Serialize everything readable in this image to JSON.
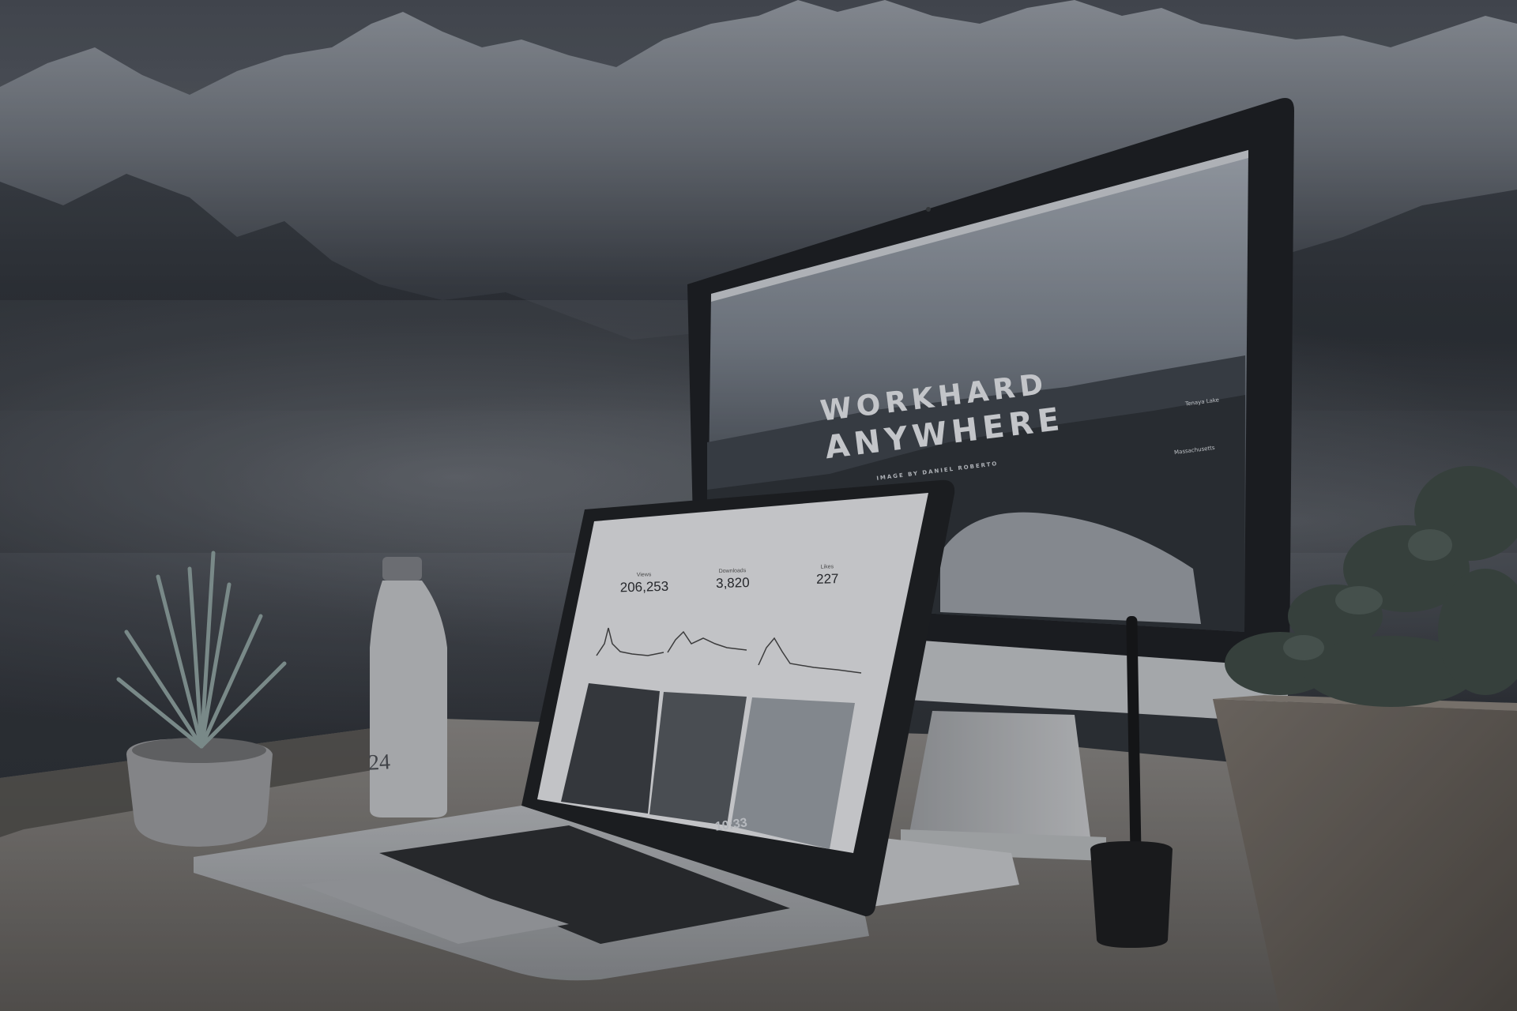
{
  "scene": {
    "description_colors": {
      "overlay": "#2b2f35",
      "screen_text": "#e9ecef"
    }
  },
  "imac": {
    "headline_line1": "WORKHARD",
    "headline_line2": "ANYWHERE",
    "credit": "IMAGE BY DANIEL ROBERTO",
    "desktop_labels": [
      "Tenaya Lake",
      "Massachusetts"
    ]
  },
  "laptop": {
    "stats": [
      {
        "label": "Views",
        "value": "206,253"
      },
      {
        "label": "Downloads",
        "value": "3,820"
      },
      {
        "label": "Likes",
        "value": "227"
      }
    ],
    "thumb_time": "10:33"
  },
  "bottle": {
    "number": "24"
  }
}
